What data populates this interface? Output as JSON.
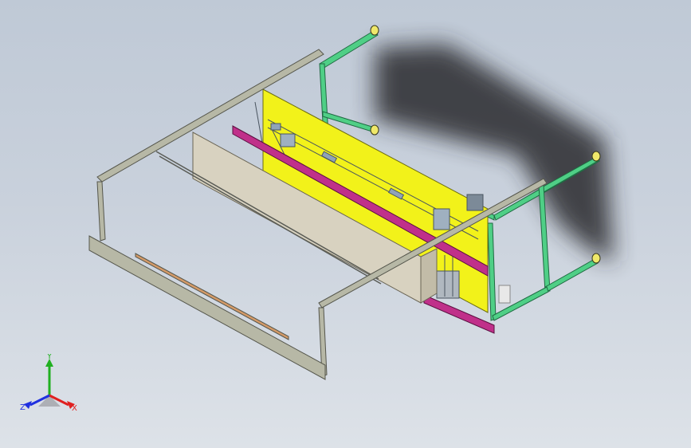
{
  "viewport": {
    "background_top": "#bfc9d6",
    "background_bottom": "#dde2e8"
  },
  "model": {
    "colors": {
      "frame_gray": "#b7b8a6",
      "frame_edge": "#55564c",
      "frame_green": "#4fcf86",
      "frame_green_edge": "#1f6a42",
      "yellow_panel": "#f2f21a",
      "magenta_rail": "#c0308a",
      "beige_plate": "#d8d2c0",
      "shadow": "#2a2c2f",
      "foot": "#efe86a"
    }
  },
  "triad": {
    "x_label": "X",
    "y_label": "Y",
    "z_label": "Z",
    "x_color": "#e02020",
    "y_color": "#20b020",
    "z_color": "#2030e0"
  }
}
